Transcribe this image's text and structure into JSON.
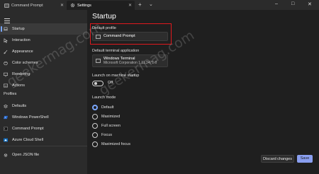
{
  "titlebar": {
    "tabs": [
      {
        "label": "Command Prompt",
        "icon": "terminal-icon"
      },
      {
        "label": "Settings",
        "icon": "gear-icon",
        "active": true
      }
    ],
    "new_tab": "+",
    "dropdown": "⌄",
    "window_controls": {
      "minimize": "–",
      "maximize": "□",
      "close": "✕"
    }
  },
  "sidebar": {
    "items": [
      {
        "label": "Startup",
        "icon": "laptop-icon",
        "selected": true
      },
      {
        "label": "Interaction",
        "icon": "cursor-icon"
      },
      {
        "label": "Appearance",
        "icon": "paintbrush-icon"
      },
      {
        "label": "Color schemes",
        "icon": "palette-icon"
      },
      {
        "label": "Rendering",
        "icon": "monitor-icon"
      },
      {
        "label": "Actions",
        "icon": "keyboard-icon"
      }
    ],
    "profiles_heading": "Profiles",
    "profiles": [
      {
        "label": "Defaults",
        "icon": "layers-icon"
      },
      {
        "label": "Windows PowerShell",
        "icon": "powershell-icon"
      },
      {
        "label": "Command Prompt",
        "icon": "terminal-icon"
      },
      {
        "label": "Azure Cloud Shell",
        "icon": "azure-icon"
      }
    ],
    "open_json": {
      "label": "Open JSON file",
      "icon": "gear-icon"
    }
  },
  "main": {
    "title": "Startup",
    "default_profile": {
      "label": "Default profile",
      "value": "Command Prompt"
    },
    "default_terminal": {
      "label": "Default terminal application",
      "value": "Windows Terminal",
      "sub": "Microsoft Corporation  1.11.3471.0"
    },
    "launch_on_startup": {
      "label": "Launch on machine startup",
      "state": "Off"
    },
    "launch_mode": {
      "label": "Launch mode",
      "options": [
        "Default",
        "Maximized",
        "Full screen",
        "Focus",
        "Maximized focus"
      ],
      "selected": "Default"
    }
  },
  "footer": {
    "discard_label": "Discard changes",
    "save_label": "Save"
  },
  "colors": {
    "accent": "#7aa7ff",
    "highlight_box": "#e0191d",
    "save_button": "#8a9ff0"
  },
  "watermark": "geekermag.com"
}
